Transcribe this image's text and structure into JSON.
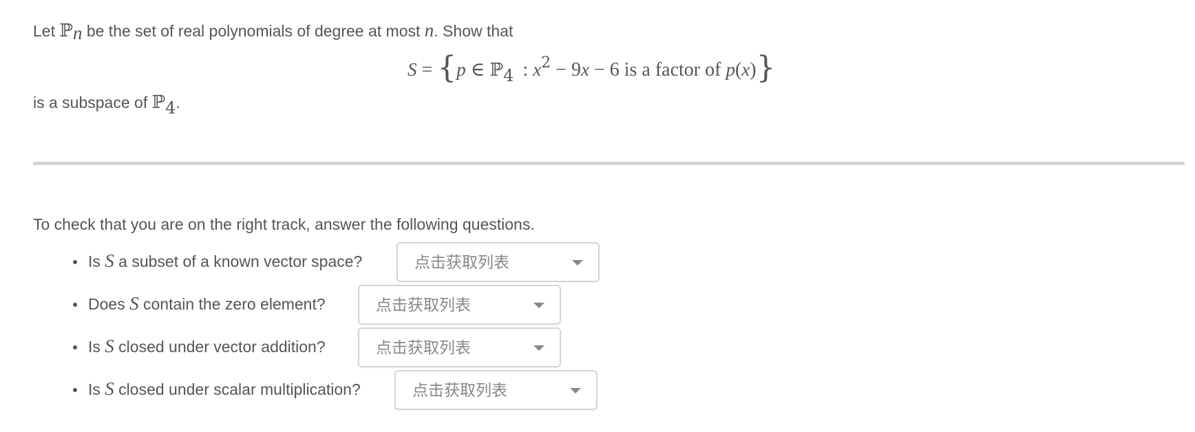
{
  "problem": {
    "intro_before": "Let",
    "intro_set": "ℙ",
    "intro_sub": "n",
    "intro_mid": "be the set of real polynomials of degree at most",
    "intro_var": "n",
    "intro_after": ".  Show that",
    "display": {
      "lhs": "S",
      "eq": "=",
      "open_brace": "{",
      "elem": "p",
      "in": "∈",
      "set": "ℙ",
      "set_sub": "4",
      "colon": ":",
      "x": "x",
      "exp": "2",
      "minus1": "−",
      "coef": "9",
      "x2": "x",
      "minus2": "−",
      "const": "6",
      "phrase": "is a factor of",
      "p": "p",
      "paren_open": "(",
      "arg": "x",
      "paren_close": ")",
      "close_brace": "}"
    },
    "conclusion_text": "is a subspace of",
    "conclusion_set": "ℙ",
    "conclusion_sub": "4",
    "conclusion_end": "."
  },
  "check": {
    "prompt": "To check that you are on the right track, answer the following questions.",
    "questions": [
      {
        "before": "Is",
        "var": "S",
        "after": "a subset of a known vector space?",
        "dropdown": "点击获取列表"
      },
      {
        "before": "Does",
        "var": "S",
        "after": "contain the zero element?",
        "dropdown": "点击获取列表"
      },
      {
        "before": "Is",
        "var": "S",
        "after": "closed under vector addition?",
        "dropdown": "点击获取列表"
      },
      {
        "before": "Is",
        "var": "S",
        "after": "closed under scalar multiplication?",
        "dropdown": "点击获取列表"
      }
    ]
  },
  "colors": {
    "text": "#555555",
    "divider": "#d4d4d4",
    "dropdown_border": "#d5d5d5",
    "placeholder": "#888888"
  }
}
